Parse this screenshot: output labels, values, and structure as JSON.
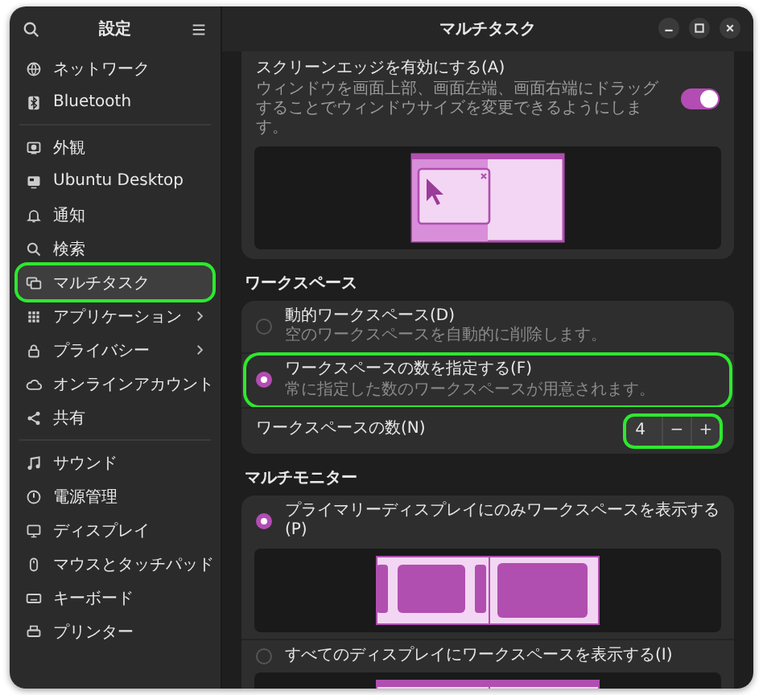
{
  "sidebar": {
    "title": "設定",
    "groups": [
      {
        "items": [
          {
            "label": "ネットワーク",
            "selected": false,
            "highlighted": false,
            "submenu": false
          },
          {
            "label": "Bluetooth",
            "selected": false,
            "highlighted": false,
            "submenu": false
          }
        ]
      },
      {
        "items": [
          {
            "label": "外観",
            "selected": false,
            "highlighted": false,
            "submenu": false
          },
          {
            "label": "Ubuntu Desktop",
            "selected": false,
            "highlighted": false,
            "submenu": false
          },
          {
            "label": "通知",
            "selected": false,
            "highlighted": false,
            "submenu": false
          },
          {
            "label": "検索",
            "selected": false,
            "highlighted": false,
            "submenu": false
          },
          {
            "label": "マルチタスク",
            "selected": true,
            "highlighted": true,
            "submenu": false
          },
          {
            "label": "アプリケーション",
            "selected": false,
            "highlighted": false,
            "submenu": true
          },
          {
            "label": "プライバシー",
            "selected": false,
            "highlighted": false,
            "submenu": true
          },
          {
            "label": "オンラインアカウント",
            "selected": false,
            "highlighted": false,
            "submenu": false
          },
          {
            "label": "共有",
            "selected": false,
            "highlighted": false,
            "submenu": false
          }
        ]
      },
      {
        "items": [
          {
            "label": "サウンド",
            "selected": false,
            "highlighted": false,
            "submenu": false
          },
          {
            "label": "電源管理",
            "selected": false,
            "highlighted": false,
            "submenu": false
          },
          {
            "label": "ディスプレイ",
            "selected": false,
            "highlighted": false,
            "submenu": false
          },
          {
            "label": "マウスとタッチパッド",
            "selected": false,
            "highlighted": false,
            "submenu": false
          },
          {
            "label": "キーボード",
            "selected": false,
            "highlighted": false,
            "submenu": false
          },
          {
            "label": "プリンター",
            "selected": false,
            "highlighted": false,
            "submenu": false
          }
        ]
      }
    ]
  },
  "page": {
    "title": "マルチタスク"
  },
  "screen_edges": {
    "title": "スクリーンエッジを有効にする(A)",
    "description": "ウィンドウを画面上部、画面左端、画面右端にドラッグすることでウィンドウサイズを変更できるようにします。",
    "on": true
  },
  "workspaces": {
    "heading": "ワークスペース",
    "options": [
      {
        "title": "動的ワークスペース(D)",
        "description": "空のワークスペースを自動的に削除します。",
        "selected": false,
        "highlighted": false
      },
      {
        "title": "ワークスペースの数を指定する(F)",
        "description": "常に指定した数のワークスペースが用意されます。",
        "selected": true,
        "highlighted": true
      }
    ],
    "count": {
      "label": "ワークスペースの数(N)",
      "value": "4",
      "decrement": "−",
      "increment": "+",
      "highlighted": true
    }
  },
  "multi_monitor": {
    "heading": "マルチモニター",
    "options": [
      {
        "title": "プライマリーディスプレイにのみワークスペースを表示する(P)",
        "selected": true,
        "kind": "primary"
      },
      {
        "title": "すべてのディスプレイにワークスペースを表示する(I)",
        "selected": false,
        "kind": "all"
      }
    ]
  }
}
